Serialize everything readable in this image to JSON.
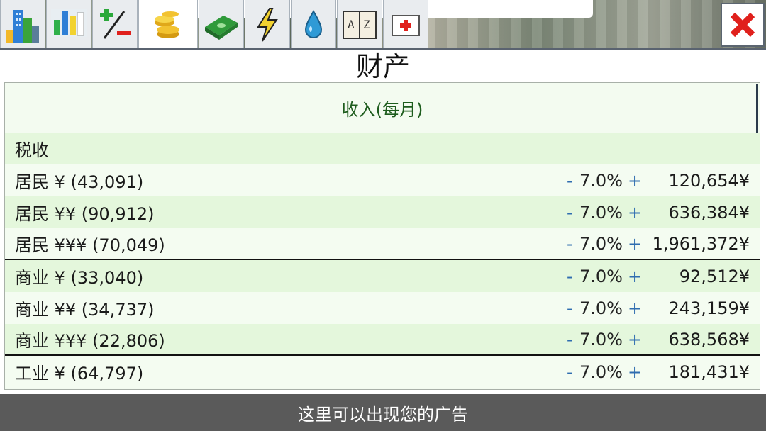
{
  "panel": {
    "title": "财产",
    "section_header": "收入(每月)",
    "category": "税收"
  },
  "tabs": [
    {
      "icon": "city-buildings-icon"
    },
    {
      "icon": "bar-chart-icon"
    },
    {
      "icon": "plus-minus-icon"
    },
    {
      "icon": "coins-icon",
      "active": true
    },
    {
      "icon": "money-stack-icon"
    },
    {
      "icon": "lightning-icon"
    },
    {
      "icon": "water-drop-icon"
    },
    {
      "icon": "az-book-icon"
    },
    {
      "icon": "medical-kit-icon"
    }
  ],
  "rows": [
    {
      "label": "居民 ¥ (43,091)",
      "minus": "-",
      "percent": "7.0%",
      "plus": "+",
      "amount": "120,654¥"
    },
    {
      "label": "居民 ¥¥ (90,912)",
      "minus": "-",
      "percent": "7.0%",
      "plus": "+",
      "amount": "636,384¥"
    },
    {
      "label": "居民 ¥¥¥ (70,049)",
      "minus": "-",
      "percent": "7.0%",
      "plus": "+",
      "amount": "1,961,372¥"
    },
    {
      "label": "商业 ¥ (33,040)",
      "minus": "-",
      "percent": "7.0%",
      "plus": "+",
      "amount": "92,512¥"
    },
    {
      "label": "商业 ¥¥ (34,737)",
      "minus": "-",
      "percent": "7.0%",
      "plus": "+",
      "amount": "243,159¥"
    },
    {
      "label": "商业 ¥¥¥ (22,806)",
      "minus": "-",
      "percent": "7.0%",
      "plus": "+",
      "amount": "638,568¥"
    },
    {
      "label": "工业 ¥ (64,797)",
      "minus": "-",
      "percent": "7.0%",
      "plus": "+",
      "amount": "181,431¥"
    }
  ],
  "ad": {
    "text": "这里可以出现您的广告"
  },
  "colors": {
    "accent_green": "#1d5c1d",
    "adjust_blue": "#2f6db0",
    "close_red": "#e0201c"
  }
}
